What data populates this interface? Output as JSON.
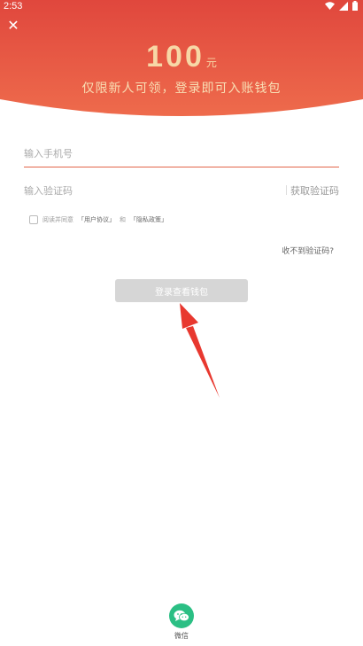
{
  "status_bar": {
    "time": "2:53"
  },
  "header": {
    "close_symbol": "✕",
    "amount": "100",
    "amount_unit": "元",
    "subtitle": "仅限新人可领，登录即可入账钱包"
  },
  "form": {
    "phone_placeholder": "输入手机号",
    "code_placeholder": "输入验证码",
    "get_code_label": "获取验证码",
    "agree_prefix": "阅读并同意",
    "user_agreement": "「用户协议」",
    "agree_and": "和",
    "privacy_policy": "「隐私政策」",
    "no_code_label": "收不到验证码?",
    "login_button": "登录查看钱包"
  },
  "social": {
    "wechat_label": "微信"
  },
  "colors": {
    "header_red_top": "#e0473d",
    "header_red_bottom": "#ed6a4c",
    "accent_underline": "#e2654a",
    "button_disabled": "#d6d6d6",
    "wechat_green": "#2bbf84",
    "arrow_red": "#e8382f"
  }
}
